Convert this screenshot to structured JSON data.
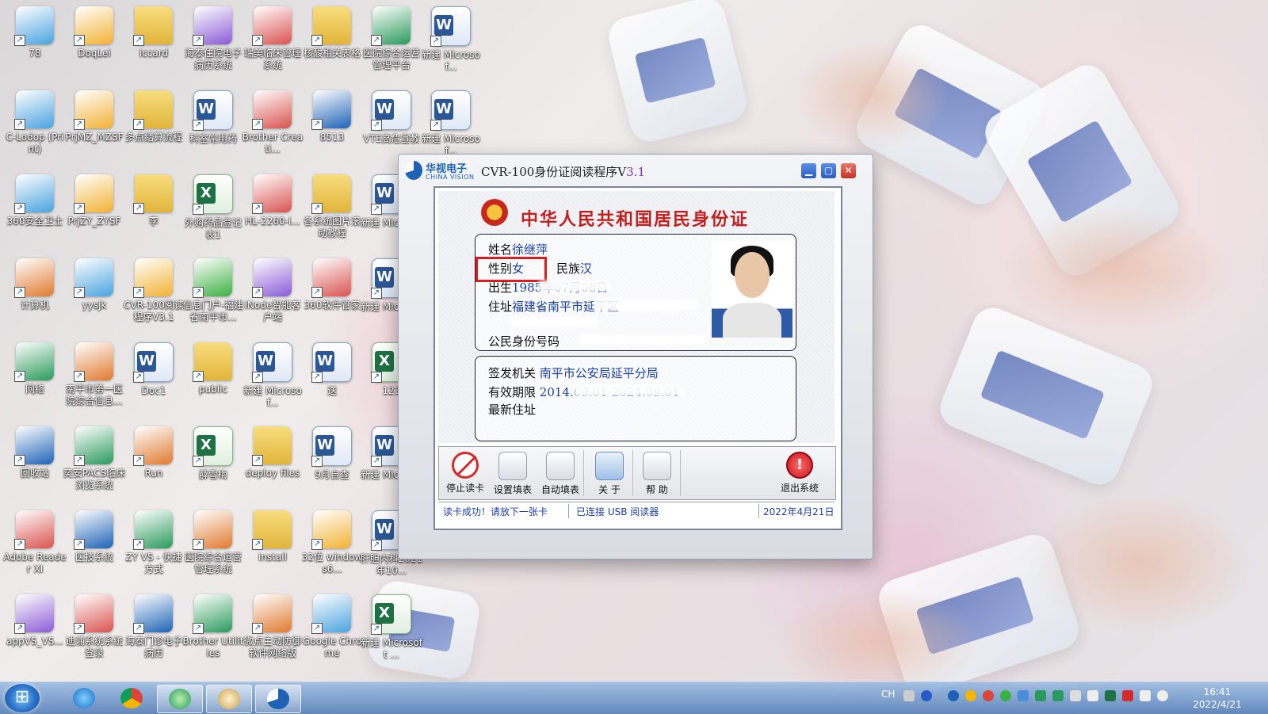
{
  "desktop": {
    "icons": [
      {
        "label": "78",
        "type": "app"
      },
      {
        "label": "DoqLei",
        "type": "app"
      },
      {
        "label": "iccard",
        "type": "folder"
      },
      {
        "label": "海泰住院电子病历系统",
        "type": "app"
      },
      {
        "label": "瑞美临床管理系统",
        "type": "app"
      },
      {
        "label": "核酸相关表格",
        "type": "folder"
      },
      {
        "label": "医院综合运营管理平台",
        "type": "app"
      },
      {
        "label": "新建 Microsof...",
        "type": "word"
      },
      {
        "label": "C-Lodop (Print)",
        "type": "app"
      },
      {
        "label": "PrjMZ_MZSF",
        "type": "app"
      },
      {
        "label": "多点结算流程",
        "type": "folder"
      },
      {
        "label": "科室常用药",
        "type": "word"
      },
      {
        "label": "Brother Creati...",
        "type": "app"
      },
      {
        "label": "8513",
        "type": "app"
      },
      {
        "label": "VTE高危宣教",
        "type": "word"
      },
      {
        "label": "新建 Microsof...",
        "type": "word"
      },
      {
        "label": "360安全卫士",
        "type": "app"
      },
      {
        "label": "PrjZY_ZYSF",
        "type": "app"
      },
      {
        "label": "李",
        "type": "folder"
      },
      {
        "label": "外购药品登记表1",
        "type": "excel"
      },
      {
        "label": "HL-2260-i...",
        "type": "app"
      },
      {
        "label": "各系统图片滚动教程",
        "type": "folder"
      },
      {
        "label": "新建 Micros...",
        "type": "word"
      },
      {
        "label": "计算机",
        "type": "app"
      },
      {
        "label": "yysjk",
        "type": "app"
      },
      {
        "label": "CVR-100阅读程序V3.1",
        "type": "app"
      },
      {
        "label": "信息门户-福建省南平市...",
        "type": "app"
      },
      {
        "label": "iNode智能客户端",
        "type": "app"
      },
      {
        "label": "360软件管家",
        "type": "app"
      },
      {
        "label": "新建 Micros...",
        "type": "word"
      },
      {
        "label": "网络",
        "type": "app"
      },
      {
        "label": "南平市第一医院综合信息...",
        "type": "app"
      },
      {
        "label": "Doc1",
        "type": "word"
      },
      {
        "label": "public",
        "type": "folder"
      },
      {
        "label": "新建 Microsof...",
        "type": "word"
      },
      {
        "label": "送",
        "type": "word"
      },
      {
        "label": "123",
        "type": "excel"
      },
      {
        "label": "回收站",
        "type": "app"
      },
      {
        "label": "奕安PACS临床浏览系统",
        "type": "app"
      },
      {
        "label": "Run",
        "type": "app"
      },
      {
        "label": "薛雪梅",
        "type": "excel"
      },
      {
        "label": "deploy files",
        "type": "folder"
      },
      {
        "label": "9月自查",
        "type": "word"
      },
      {
        "label": "新建 Micros...",
        "type": "word"
      },
      {
        "label": "Adobe Reader XI",
        "type": "app"
      },
      {
        "label": "医技系统",
        "type": "app"
      },
      {
        "label": "ZY VS - 快捷方式",
        "type": "app"
      },
      {
        "label": "医院综合运营管理系统",
        "type": "app"
      },
      {
        "label": "install",
        "type": "folder"
      },
      {
        "label": "32位 windows6...",
        "type": "app"
      },
      {
        "label": "肝胆内科2021年10...",
        "type": "word"
      },
      {
        "label": "appVS_VS...",
        "type": "app"
      },
      {
        "label": "迪浦系统系统登录",
        "type": "app"
      },
      {
        "label": "海泰门诊电子病历",
        "type": "app"
      },
      {
        "label": "Brother Utilities",
        "type": "app"
      },
      {
        "label": "微点主动防御软件网络版",
        "type": "app"
      },
      {
        "label": "Google Chrome",
        "type": "app"
      },
      {
        "label": "新建 Microsoft ...",
        "type": "excel"
      }
    ]
  },
  "window": {
    "brand_cn": "华视电子",
    "brand_en": "CHINA VISION",
    "title_main": "CVR-100身份证阅读程序V",
    "title_ver": "3.1",
    "card_title": "中华人民共和国居民身份证",
    "fields": {
      "name_label": "姓名",
      "name_value": "徐继萍",
      "sex_label": "性别",
      "sex_value": "女",
      "ethnicity_label": "民族",
      "ethnicity_value": "汉",
      "birth_label": "出生",
      "birth_value": "1985年07月08日",
      "address_label": "住址",
      "address_value": "福建省南平市延平区",
      "id_label": "公民身份号码",
      "authority_label": "签发机关",
      "authority_value": "南平市公安局延平分局",
      "validity_label": "有效期限",
      "validity_value": "2014.09.01-2024.09.01",
      "new_address_label": "最新住址"
    },
    "toolbar": {
      "stop": "停止读卡",
      "settings": "设置填表",
      "autofill": "自动填表",
      "about": "关 于",
      "help": "帮 助",
      "exit": "退出系统"
    },
    "status": {
      "read_msg": "读卡成功！请放下一张卡",
      "connection": "已连接 USB 阅读器",
      "date": "2022年4月21日"
    },
    "colors": {
      "title_red": "#c2201d",
      "value_blue": "#1a3fa8",
      "highlight_red": "#e01b1b"
    }
  },
  "taskbar": {
    "language": "CH",
    "time": "16:41",
    "date": "2022/4/21"
  }
}
